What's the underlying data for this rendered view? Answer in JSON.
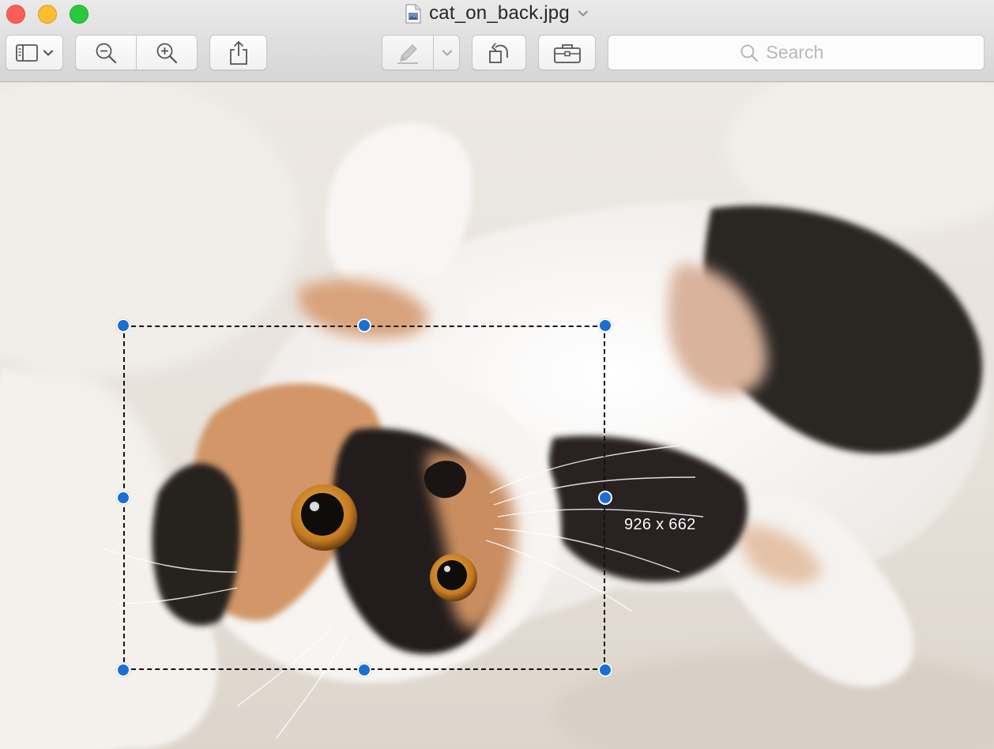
{
  "window": {
    "title": "cat_on_back.jpg",
    "traffic_lights": {
      "close": "#fc5f57",
      "minimize": "#fdbc2e",
      "zoom": "#28c840"
    }
  },
  "toolbar": {
    "buttons": [
      {
        "name": "sidebar-toggle-button",
        "icon": "sidebar-icon"
      },
      {
        "name": "zoom-out-button",
        "icon": "zoom-out-icon"
      },
      {
        "name": "zoom-in-button",
        "icon": "zoom-in-icon"
      },
      {
        "name": "share-button",
        "icon": "share-icon"
      },
      {
        "name": "markup-button",
        "icon": "pen-icon"
      },
      {
        "name": "rotate-button",
        "icon": "rotate-left-icon"
      },
      {
        "name": "toolbox-button",
        "icon": "toolbox-icon"
      }
    ],
    "search": {
      "placeholder": "Search",
      "value": ""
    }
  },
  "selection": {
    "size_label": "926 x 662",
    "handle_color": "#1c6fd1"
  },
  "image": {
    "subject": "calico cat lying on its back"
  }
}
